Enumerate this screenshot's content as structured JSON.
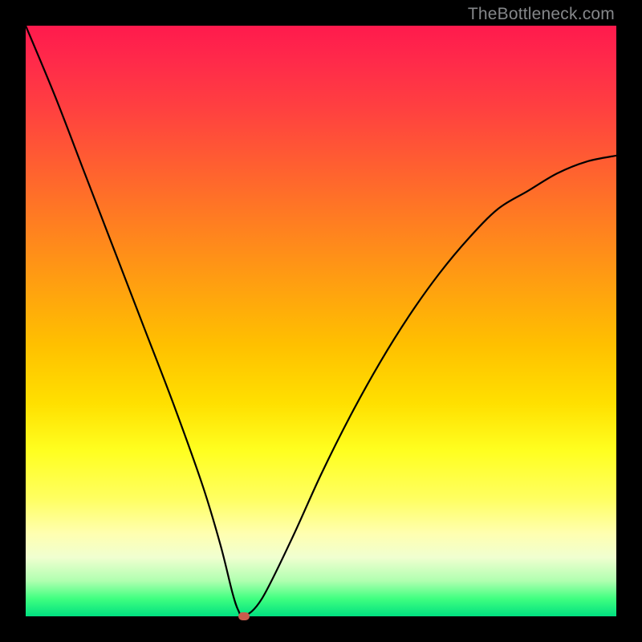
{
  "watermark": "TheBottleneck.com",
  "colors": {
    "frame": "#000000",
    "marker": "#c95c4d",
    "curve": "#000000"
  },
  "chart_data": {
    "type": "line",
    "title": "",
    "xlabel": "",
    "ylabel": "",
    "x_range": [
      0,
      100
    ],
    "y_range": [
      0,
      100
    ],
    "grid": false,
    "legend": false,
    "series": [
      {
        "name": "bottleneck-curve",
        "x": [
          0,
          5,
          10,
          15,
          20,
          25,
          30,
          33,
          35,
          36,
          37,
          40,
          45,
          50,
          55,
          60,
          65,
          70,
          75,
          80,
          85,
          90,
          95,
          100
        ],
        "y": [
          100,
          88,
          75,
          62,
          49,
          36,
          22,
          12,
          4,
          1,
          0,
          3,
          13,
          24,
          34,
          43,
          51,
          58,
          64,
          69,
          72,
          75,
          77,
          78
        ]
      }
    ],
    "minimum_point": {
      "x": 37,
      "y": 0
    },
    "annotations": []
  }
}
